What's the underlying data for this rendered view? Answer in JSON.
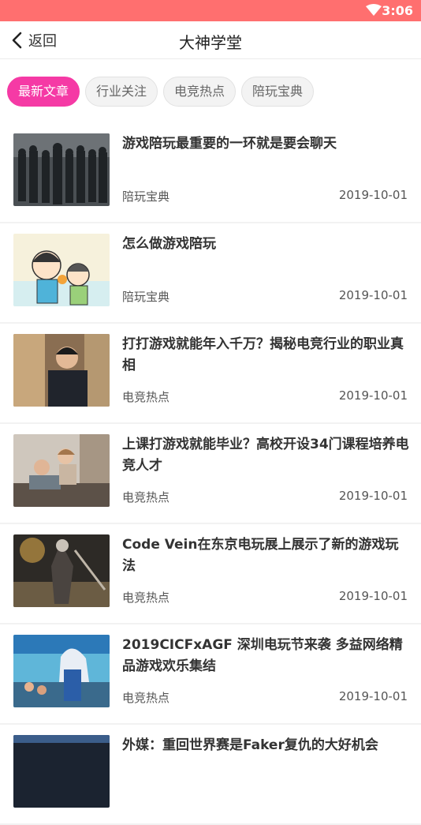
{
  "status_bar": {
    "time": "3:06"
  },
  "nav": {
    "back_label": "返回",
    "title": "大神学堂"
  },
  "tabs": [
    {
      "label": "最新文章",
      "active": true
    },
    {
      "label": "行业关注",
      "active": false
    },
    {
      "label": "电竞热点",
      "active": false
    },
    {
      "label": "陪玩宝典",
      "active": false
    }
  ],
  "articles": [
    {
      "title": "游戏陪玩最重要的一环就是要会聊天",
      "category": "陪玩宝典",
      "date": "2019-10-01",
      "thumb": "soldiers-crowd"
    },
    {
      "title": "怎么做游戏陪玩",
      "category": "陪玩宝典",
      "date": "2019-10-01",
      "thumb": "cartoon-couple"
    },
    {
      "title": "打打游戏就能年入千万？揭秘电竞行业的职业真相",
      "category": "电竞热点",
      "date": "2019-10-01",
      "thumb": "player-portrait"
    },
    {
      "title": "上课打游戏就能毕业？高校开设34门课程培养电竞人才",
      "category": "电竞热点",
      "date": "2019-10-01",
      "thumb": "gamers-couch"
    },
    {
      "title": "Code Vein在东京电玩展上展示了新的游戏玩法",
      "category": "电竞热点",
      "date": "2019-10-01",
      "thumb": "fantasy-warrior"
    },
    {
      "title": "2019CICFxAGF 深圳电玩节来袭 多益网络精品游戏欢乐集结",
      "category": "电竞热点",
      "date": "2019-10-01",
      "thumb": "cosplay-expo"
    },
    {
      "title": "外媒：重回世界赛是Faker复仇的大好机会",
      "category": "",
      "date": "",
      "thumb": "stage-dark"
    }
  ]
}
